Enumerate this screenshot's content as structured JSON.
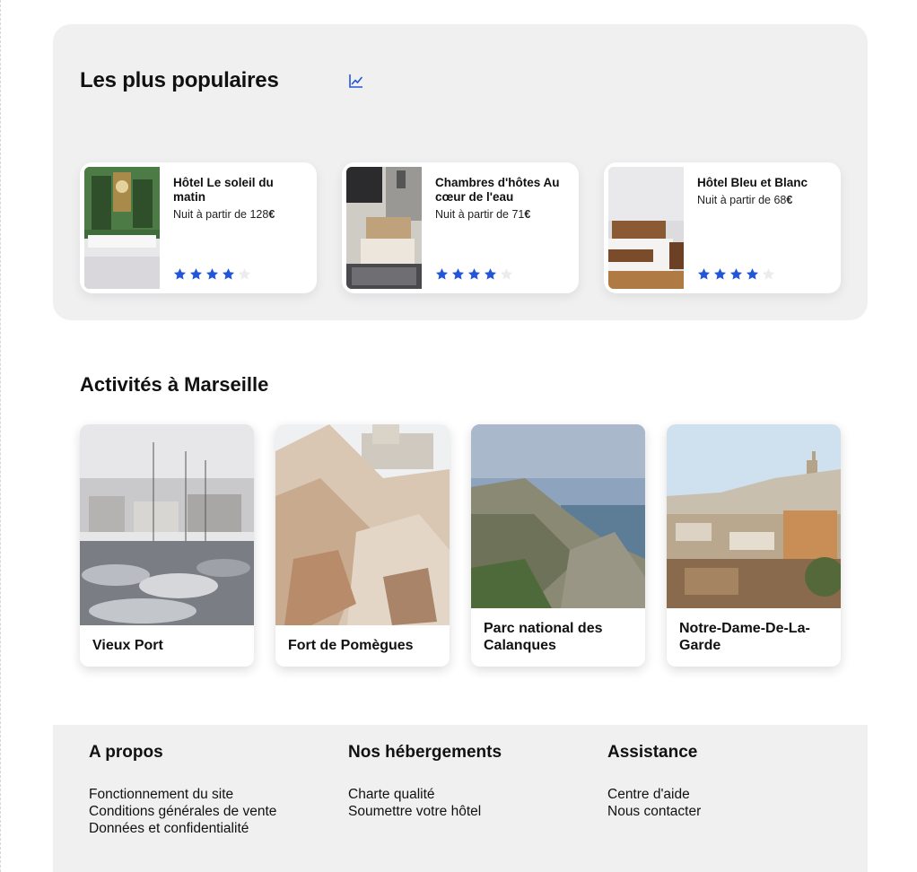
{
  "popular": {
    "title": "Les plus populaires",
    "icon": "trend-chart-icon",
    "accent": "#2355d9",
    "hotels": [
      {
        "name": "Hôtel Le soleil du matin",
        "price_prefix": "Nuit à partir de 128",
        "currency": "€",
        "rating": 4,
        "max_rating": 5
      },
      {
        "name": "Chambres d'hôtes Au cœur de l'eau",
        "price_prefix": "Nuit à partir de 71",
        "currency": "€",
        "rating": 4,
        "max_rating": 5
      },
      {
        "name": "Hôtel Bleu et Blanc",
        "price_prefix": "Nuit à partir de 68",
        "currency": "€",
        "rating": 4,
        "max_rating": 5
      }
    ]
  },
  "activities": {
    "title": "Activités à Marseille",
    "items": [
      {
        "label": "Vieux Port"
      },
      {
        "label": "Fort de Pomègues"
      },
      {
        "label": "Parc national des Calanques"
      },
      {
        "label": "Notre-Dame-De-La-Garde"
      }
    ]
  },
  "footer": {
    "columns": [
      {
        "title": "A propos",
        "links": [
          "Fonctionnement du site",
          "Conditions générales de vente",
          "Données et confidentialité"
        ]
      },
      {
        "title": "Nos hébergements",
        "links": [
          "Charte qualité",
          "Soumettre votre hôtel"
        ]
      },
      {
        "title": "Assistance",
        "links": [
          "Centre d'aide",
          "Nous contacter"
        ]
      }
    ]
  }
}
